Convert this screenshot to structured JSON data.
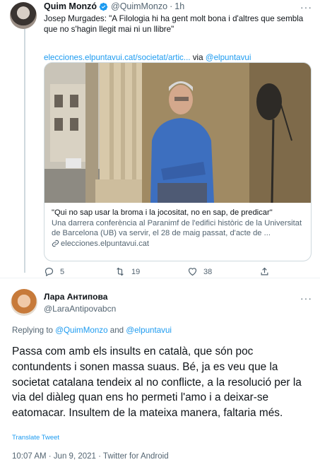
{
  "tweet1": {
    "name": "Quim Monzó",
    "handle": "@QuimMonzo",
    "separator": "·",
    "time": "1h",
    "text": "Josep Murgades: \"A Filologia hi ha gent molt bona i d'altres que sembla que no s'hagin llegit mai ni un llibre\"",
    "link_url": "elecciones.elpuntavui.cat/societat/artic...",
    "via_word": "via",
    "via_handle": "@elpuntavui",
    "card": {
      "title": "\"Qui no sap usar la broma i la jocositat, no en sap, de predicar\"",
      "description": "Una darrera conferència al Paranimf de l'edifici històric de la Universitat de Barcelona (UB) va servir, el 28 de maig passat, d'acte de ...",
      "domain": "elecciones.elpuntavui.cat"
    },
    "actions": {
      "replies": "5",
      "retweets": "19",
      "likes": "38"
    }
  },
  "tweet2": {
    "name": "Лара Антипова",
    "handle": "@LaraAntipovabcn",
    "replying_prefix": "Replying to",
    "replying_to_1": "@QuimMonzo",
    "replying_and": "and",
    "replying_to_2": "@elpuntavui",
    "text": "Passa com amb els insults en català, que són poc contundents i sonen massa suaus. Bé, ja es veu que la societat catalana tendeix al no conflicte, a la resolució per la via del diàleg quan ens ho permeti l'amo i a deixar-se eatomacar. Insultem de la mateixa manera, faltaria més.",
    "translate_label": "Translate Tweet",
    "meta": "10:07 AM · Jun 9, 2021 · Twitter for Android"
  },
  "colors": {
    "accent": "#1d9bf0",
    "secondary_text": "#536471",
    "border": "#cfd9de"
  },
  "icons": [
    "more-icon",
    "verified-icon",
    "reply-icon",
    "retweet-icon",
    "like-icon",
    "share-icon",
    "link-icon"
  ]
}
